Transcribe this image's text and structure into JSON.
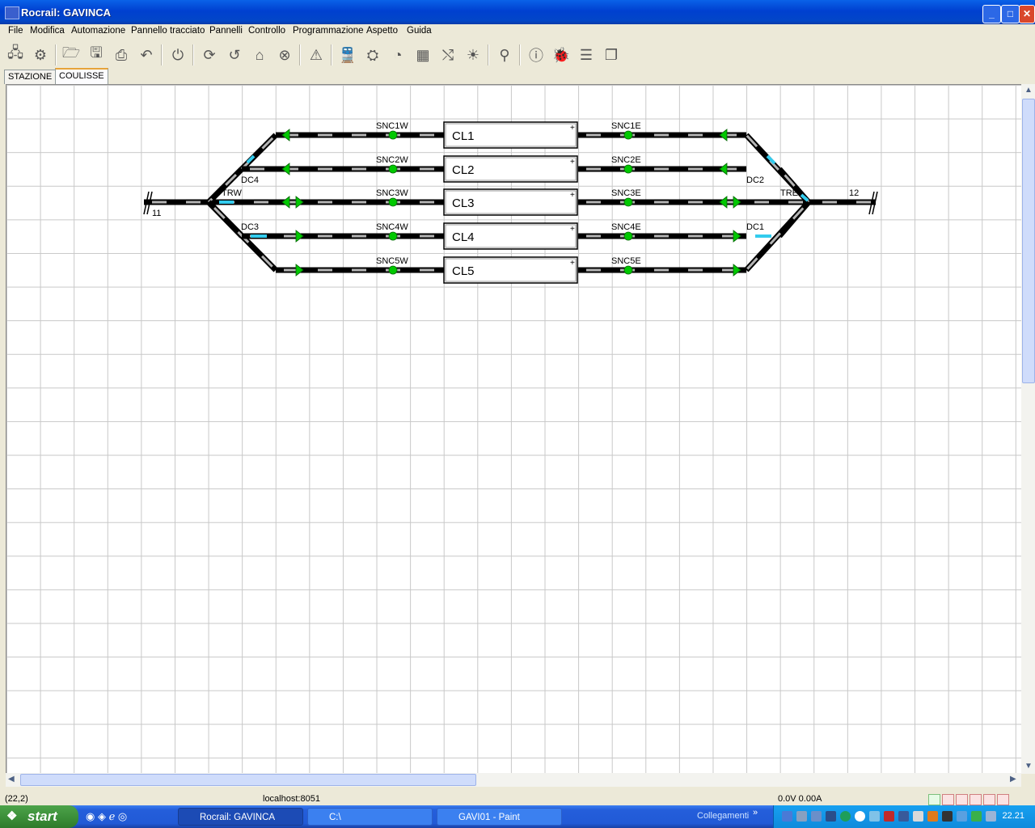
{
  "window": {
    "title": "Rocrail: GAVINCA",
    "buttons": {
      "minimize": "_",
      "maximize": "□",
      "close": "✕"
    }
  },
  "menu": [
    "File",
    "Modifica",
    "Automazione",
    "Pannello tracciato",
    "Pannelli",
    "Controllo",
    "Programmazione",
    "Aspetto",
    "Guida"
  ],
  "toolbar_icons": [
    "network-icon",
    "settings-icon",
    "open-folder-icon",
    "save-icon",
    "print-icon",
    "undo-icon",
    "power-icon",
    "loop-icon",
    "rotate-icon",
    "home-icon",
    "cancel-icon",
    "warning-icon",
    "locomotive-icon",
    "throttle-icon",
    "speedometer-icon",
    "route-icon",
    "shuffle-icon",
    "light-icon",
    "search-icon",
    "info-icon",
    "bug-icon",
    "list-icon",
    "copy-icon"
  ],
  "tabs": [
    "STAZIONE",
    "COULISSE"
  ],
  "active_tab": "COULISSE",
  "plan": {
    "blocks": [
      "CL1",
      "CL2",
      "CL3",
      "CL4",
      "CL5"
    ],
    "sensors_west": [
      "SNC1W",
      "SNC2W",
      "SNC3W",
      "SNC4W",
      "SNC5W"
    ],
    "sensors_east": [
      "SNC1E",
      "SNC2E",
      "SNC3E",
      "SNC4E",
      "SNC5E"
    ],
    "switches": {
      "dc4": "DC4",
      "dc3": "DC3",
      "dc2": "DC2",
      "dc1": "DC1",
      "trw": "TRW",
      "tre": "TRE"
    },
    "ends": {
      "west": "11",
      "east": "12"
    }
  },
  "status": {
    "coords": "(22,2)",
    "server": "localhost:8051",
    "power": "0.0V 0.00A"
  },
  "taskbar": {
    "start": "start",
    "tasks": [
      {
        "label": "Rocrail: GAVINCA",
        "active": true
      },
      {
        "label": "C:\\",
        "active": false
      },
      {
        "label": "GAVI01 - Paint",
        "active": false
      }
    ],
    "links": "Collegamenti",
    "clock": "22.21"
  },
  "colors": {
    "track": "#000000",
    "signal_green": "#00c800",
    "switch_cyan": "#33ccee",
    "titlebar": "#0a4fd8"
  }
}
